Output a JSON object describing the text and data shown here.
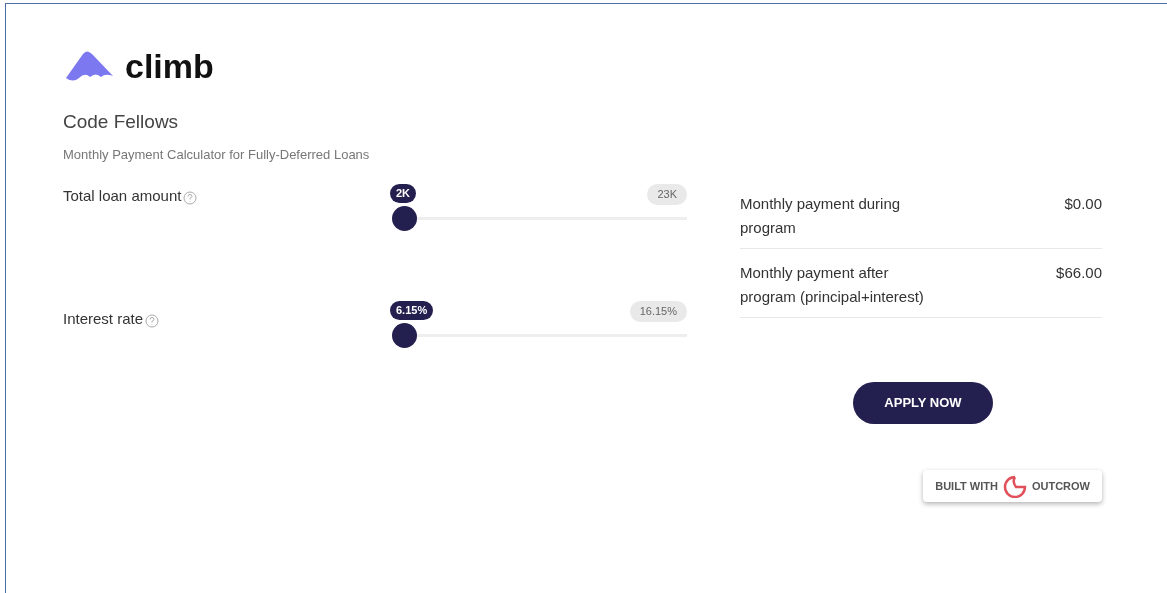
{
  "brand": {
    "name": "climb"
  },
  "title": "Code Fellows",
  "subtitle": "Monthly Payment Calculator for Fully-Deferred Loans",
  "sliders": [
    {
      "label": "Total loan amount",
      "value": "2K",
      "max": "23K",
      "level": 0
    },
    {
      "label": "Interest rate",
      "value": "6.15%",
      "max": "16.15%",
      "level": 0
    }
  ],
  "results": [
    {
      "label": "Monthly payment during program",
      "amount": "$0.00"
    },
    {
      "label": "Monthly payment after program (principal+interest)",
      "amount": "$66.00"
    }
  ],
  "apply_button": "APPLY NOW",
  "built_with": {
    "prefix": "BUILT WITH",
    "brand": "OUTCROW"
  }
}
